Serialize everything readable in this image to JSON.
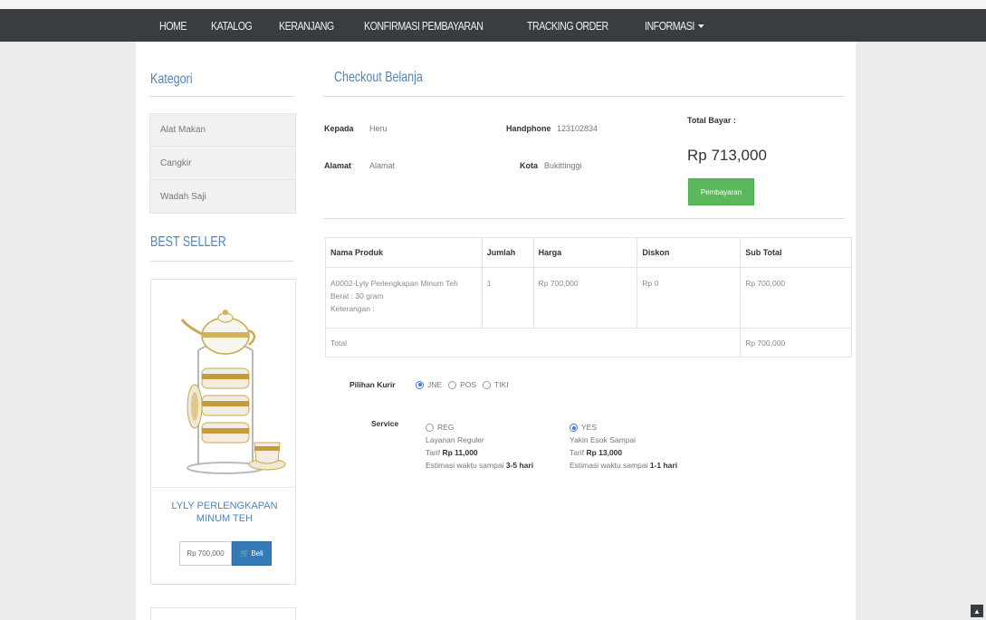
{
  "navbar": {
    "items": [
      {
        "label": "HOME"
      },
      {
        "label": "KATALOG"
      },
      {
        "label": "KERANJANG"
      },
      {
        "label": "KONFIRMASI PEMBAYARAN"
      },
      {
        "label": "TRACKING ORDER"
      },
      {
        "label": "INFORMASI"
      }
    ]
  },
  "sidebar": {
    "category_title": "Kategori",
    "categories": [
      {
        "label": "Alat Makan"
      },
      {
        "label": "Cangkir"
      },
      {
        "label": "Wadah Saji"
      }
    ],
    "best_seller_title": "BEST SELLER",
    "product": {
      "name": "LYLY PERLENGKAPAN MINUM TEH",
      "price": "Rp 700,000",
      "buy_label": "Beli"
    }
  },
  "checkout": {
    "title": "Checkout Belanja",
    "kepada_label": "Kepada",
    "kepada_value": "Heru",
    "alamat_label": "Alamat",
    "alamat_value": "Alamat",
    "handphone_label": "Handphone",
    "handphone_value": "123102834",
    "kota_label": "Kota",
    "kota_value": "Bukittinggi",
    "total_label": "Total Bayar :",
    "total_value": "Rp 713,000",
    "pay_button": "Pembayaran"
  },
  "table": {
    "headers": [
      "Nama Produk",
      "Jumlah",
      "Harga",
      "Diskon",
      "Sub Total"
    ],
    "row": {
      "product_line1": "A0002-Lyly Perlengkapan Minum Teh",
      "product_line2": "Berat : 30 gram",
      "product_line3": "Keterangan :",
      "qty": "1",
      "price": "Rp 700,000",
      "discount": "Rp 0",
      "subtotal": "Rp 700,000"
    },
    "total_label": "Total",
    "total_value": "Rp 700,000"
  },
  "courier": {
    "label": "Pilihan Kurir",
    "options": [
      {
        "label": "JNE",
        "selected": true
      },
      {
        "label": "POS",
        "selected": false
      },
      {
        "label": "TIKI",
        "selected": false
      }
    ]
  },
  "service": {
    "label": "Service",
    "options": [
      {
        "code": "REG",
        "selected": false,
        "name": "Layanan Reguler",
        "tarif_prefix": "Tarif",
        "tarif": "Rp 11,000",
        "estimate_prefix": "Estimasi waktu sampai",
        "estimate": "3-5 hari"
      },
      {
        "code": "YES",
        "selected": true,
        "name": "Yakin Esok Sampai",
        "tarif_prefix": "Tarif",
        "tarif": "Rp 13,000",
        "estimate_prefix": "Estimasi waktu sampai",
        "estimate": "1-1 hari"
      }
    ]
  },
  "colors": {
    "navbar_bg": "#3a3d40",
    "link_blue": "#4f84b8",
    "primary_btn": "#337ab7",
    "success_btn": "#5cb85c"
  }
}
